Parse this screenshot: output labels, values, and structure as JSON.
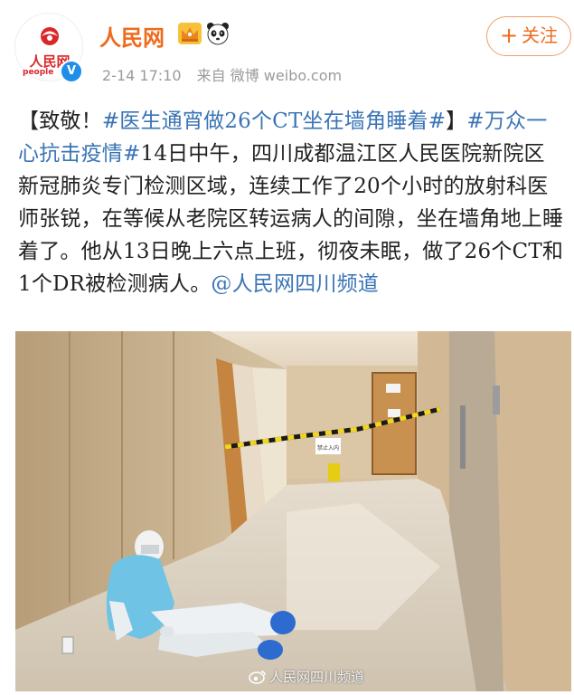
{
  "account": {
    "name": "人民网",
    "avatar_text": "人民网",
    "avatar_text_en": "people",
    "verified_mark": "V",
    "badges": [
      "crown-icon",
      "panda-icon"
    ]
  },
  "meta": {
    "time": "2-14 17:10",
    "source": "来自 微博 weibo.com"
  },
  "follow": {
    "plus": "+",
    "label": "关注"
  },
  "post": {
    "open_bracket": "【致敬！",
    "tag1": "#医生通宵做26个CT坐在墙角睡着#",
    "close_bracket": "】",
    "tag2": "#万众一心抗击疫情#",
    "body": "14日中午，四川成都温江区人民医院新院区新冠肺炎专门检测区域，连续工作了20个小时的放射科医师张锐，在等候从老院区转运病人的间隙，坐在墙角地上睡着了。他从13日晚上六点上班，彻夜未眠，做了26个CT和1个DR被检测病人。",
    "mention": "@人民网四川频道"
  },
  "photo": {
    "alt": "医生坐在墙角睡着",
    "sign1": "禁止入内",
    "watermark": "人民网四川频道"
  },
  "colors": {
    "accent": "#ee6b1c",
    "link": "#3a74b5",
    "meta": "#9a9a9a",
    "brand_red": "#d9282a"
  }
}
